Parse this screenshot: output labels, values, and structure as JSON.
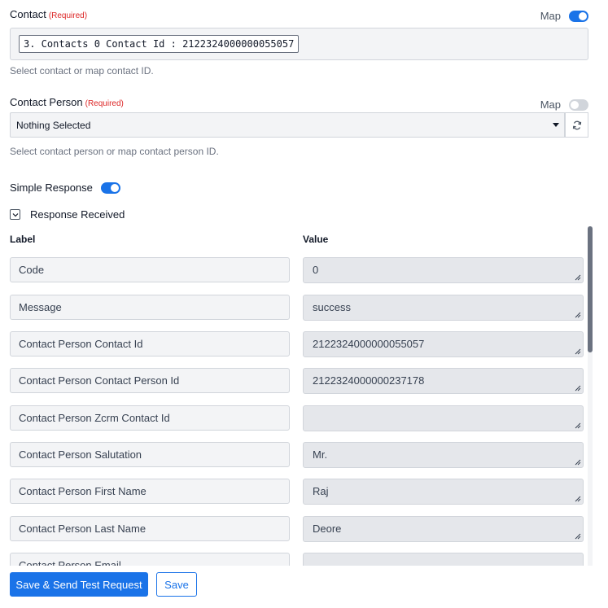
{
  "contact": {
    "label": "Contact",
    "required": "(Required)",
    "map_label": "Map",
    "map_on": true,
    "mapped_value": "3. Contacts 0 Contact Id : 2122324000000055057",
    "help": "Select contact or map contact ID."
  },
  "contact_person": {
    "label": "Contact Person",
    "required": "(Required)",
    "map_label": "Map",
    "map_on": false,
    "selected": "Nothing Selected",
    "help": "Select contact person or map contact person ID."
  },
  "simple_response": {
    "label": "Simple Response",
    "on": true
  },
  "response_received": {
    "label": "Response Received"
  },
  "table": {
    "label_header": "Label",
    "value_header": "Value",
    "rows": [
      {
        "label": "Code",
        "value": "0"
      },
      {
        "label": "Message",
        "value": "success"
      },
      {
        "label": "Contact Person Contact Id",
        "value": "2122324000000055057"
      },
      {
        "label": "Contact Person Contact Person Id",
        "value": "2122324000000237178"
      },
      {
        "label": "Contact Person Zcrm Contact Id",
        "value": ""
      },
      {
        "label": "Contact Person Salutation",
        "value": "Mr."
      },
      {
        "label": "Contact Person First Name",
        "value": "Raj"
      },
      {
        "label": "Contact Person Last Name",
        "value": "Deore"
      },
      {
        "label": "Contact Person Email",
        "value": ""
      }
    ]
  },
  "buttons": {
    "save_send": "Save & Send Test Request",
    "save": "Save"
  },
  "colors": {
    "accent": "#1a73e8",
    "required": "#dc2626"
  }
}
